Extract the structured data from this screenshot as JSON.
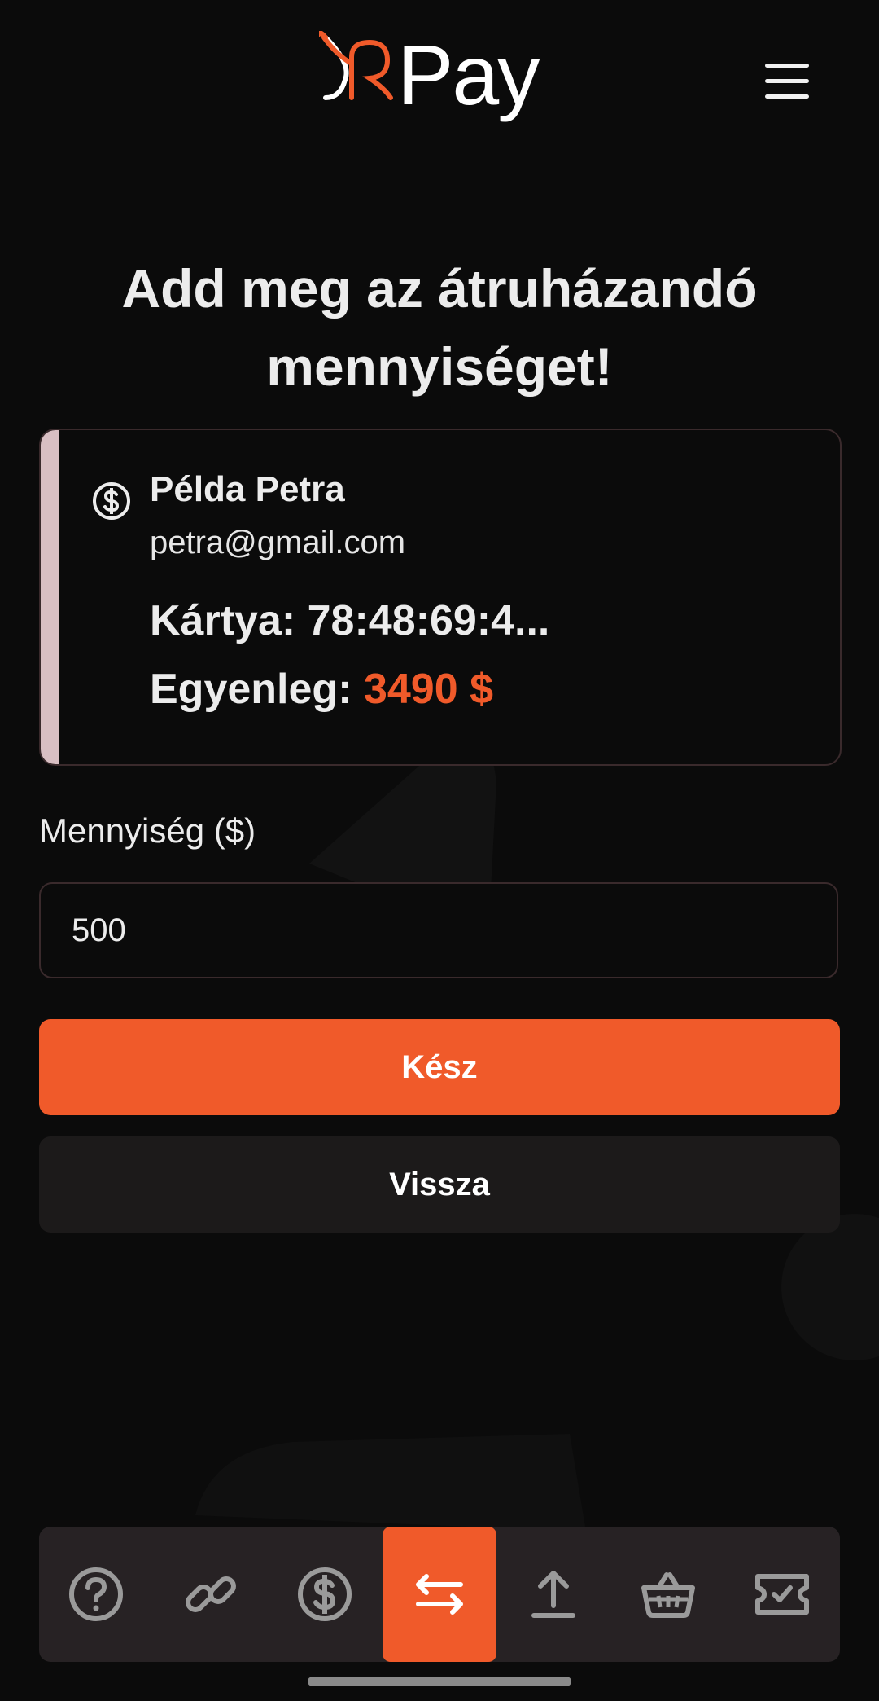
{
  "app": {
    "brand_text": "Pay"
  },
  "page": {
    "title": "Add meg az átruházandó mennyiséget!"
  },
  "recipient": {
    "name": "Példa Petra",
    "email": "petra@gmail.com",
    "card_label": "Kártya:",
    "card_value": "78:48:69:4...",
    "balance_label": "Egyenleg:",
    "balance_value": "3490 $"
  },
  "form": {
    "amount_label": "Mennyiség ($)",
    "amount_value": "500"
  },
  "buttons": {
    "done_label": "Kész",
    "back_label": "Vissza"
  },
  "nav": {
    "items": [
      {
        "icon": "help-icon"
      },
      {
        "icon": "link-icon"
      },
      {
        "icon": "dollar-icon"
      },
      {
        "icon": "transfer-icon",
        "active": true
      },
      {
        "icon": "upload-icon"
      },
      {
        "icon": "basket-icon"
      },
      {
        "icon": "ticket-icon"
      }
    ]
  },
  "colors": {
    "accent": "#f05a2a",
    "background": "#0b0b0b",
    "card_border": "#3a2a2c",
    "nav_bg": "#272224"
  }
}
